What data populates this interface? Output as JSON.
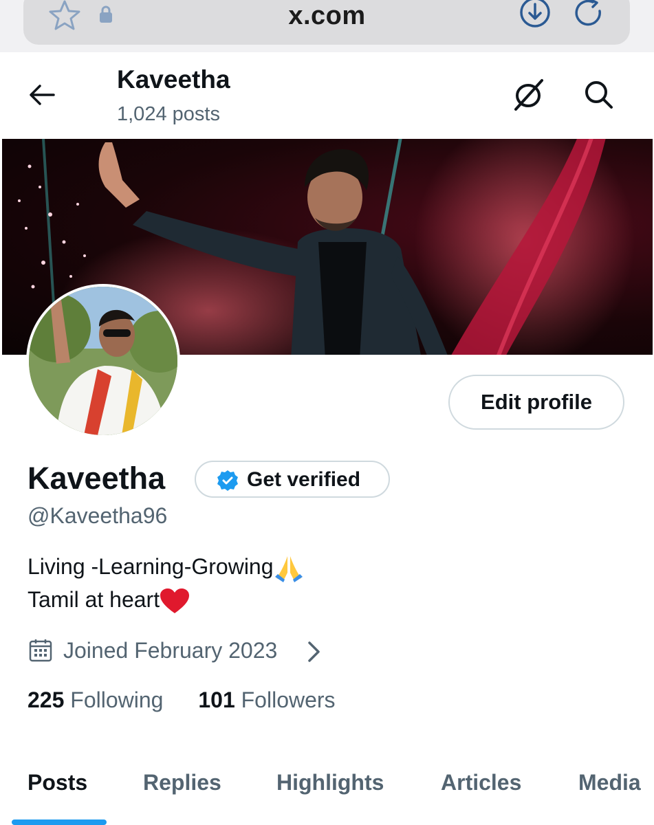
{
  "browser": {
    "url": "x.com"
  },
  "header": {
    "name": "Kaveetha",
    "post_count": "1,024 posts"
  },
  "profile": {
    "edit_label": "Edit profile",
    "display_name": "Kaveetha",
    "verify_label": "Get verified",
    "handle": "@Kaveetha96",
    "bio_line1": "Living -Learning-Growing",
    "bio_line2": "Tamil at heart",
    "joined": "Joined February 2023",
    "following_count": "225",
    "following_label": "Following",
    "followers_count": "101",
    "followers_label": "Followers"
  },
  "tabs": [
    {
      "label": "Posts"
    },
    {
      "label": "Replies"
    },
    {
      "label": "Highlights"
    },
    {
      "label": "Articles"
    },
    {
      "label": "Media"
    }
  ],
  "colors": {
    "accent": "#1d9bf0",
    "text": "#0f1419",
    "secondary": "#536471",
    "browser_icon": "#2b5a93"
  }
}
